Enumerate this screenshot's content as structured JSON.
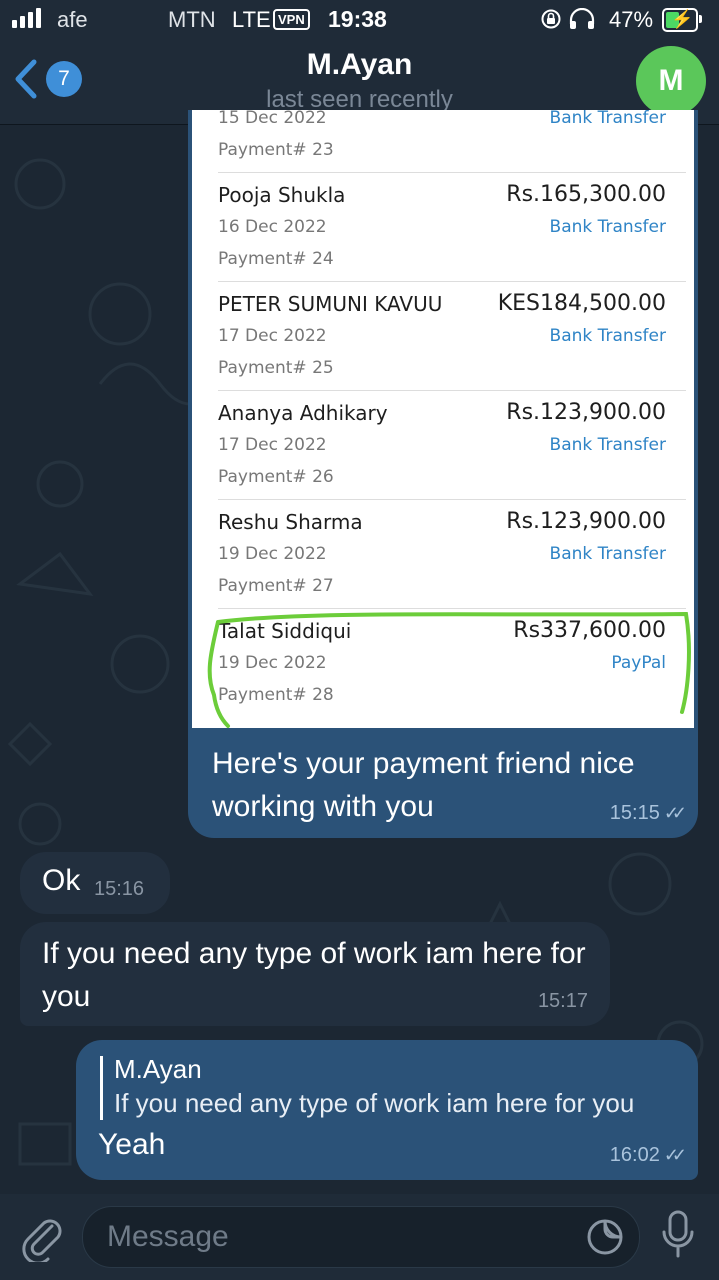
{
  "status_bar": {
    "carrier_left": "afe",
    "carrier": "MTN",
    "network": "LTE",
    "vpn": "VPN",
    "time": "19:38",
    "battery": "47%"
  },
  "header": {
    "back_count": "7",
    "title": "M.Ayan",
    "subtitle": "last seen recently",
    "avatar_letter": "M"
  },
  "payments": [
    {
      "name": "",
      "amount": "",
      "date": "15 Dec 2022",
      "method": "Bank Transfer",
      "number": "Payment# 23"
    },
    {
      "name": "Pooja Shukla",
      "amount": "Rs.165,300.00",
      "date": "16 Dec 2022",
      "method": "Bank Transfer",
      "number": "Payment# 24"
    },
    {
      "name": "PETER SUMUNI KAVUU",
      "amount": "KES184,500.00",
      "date": "17 Dec 2022",
      "method": "Bank Transfer",
      "number": "Payment# 25"
    },
    {
      "name": "Ananya Adhikary",
      "amount": "Rs.123,900.00",
      "date": "17 Dec 2022",
      "method": "Bank Transfer",
      "number": "Payment# 26"
    },
    {
      "name": "Reshu Sharma",
      "amount": "Rs.123,900.00",
      "date": "19 Dec 2022",
      "method": "Bank Transfer",
      "number": "Payment# 27"
    },
    {
      "name": "Talat Siddiqui",
      "amount": "Rs337,600.00",
      "date": "19 Dec 2022",
      "method": "PayPal",
      "number": "Payment# 28"
    }
  ],
  "messages": {
    "image_caption": "Here's your payment friend nice working with you",
    "image_caption_time": "15:15",
    "ok_text": "Ok",
    "ok_time": "15:16",
    "work_text": "If you need any type of work iam here for you",
    "work_time": "15:17",
    "reply_quote_name": "M.Ayan",
    "reply_quote_text": "If you need any type of work iam here for you",
    "reply_text": "Yeah",
    "reply_time": "16:02"
  },
  "input": {
    "placeholder": "Message"
  },
  "colors": {
    "accent": "#3f8fd8",
    "outgoing_bubble": "#2b5278",
    "incoming_bubble": "#222f3e",
    "highlight_marker": "#6ccd3a"
  }
}
